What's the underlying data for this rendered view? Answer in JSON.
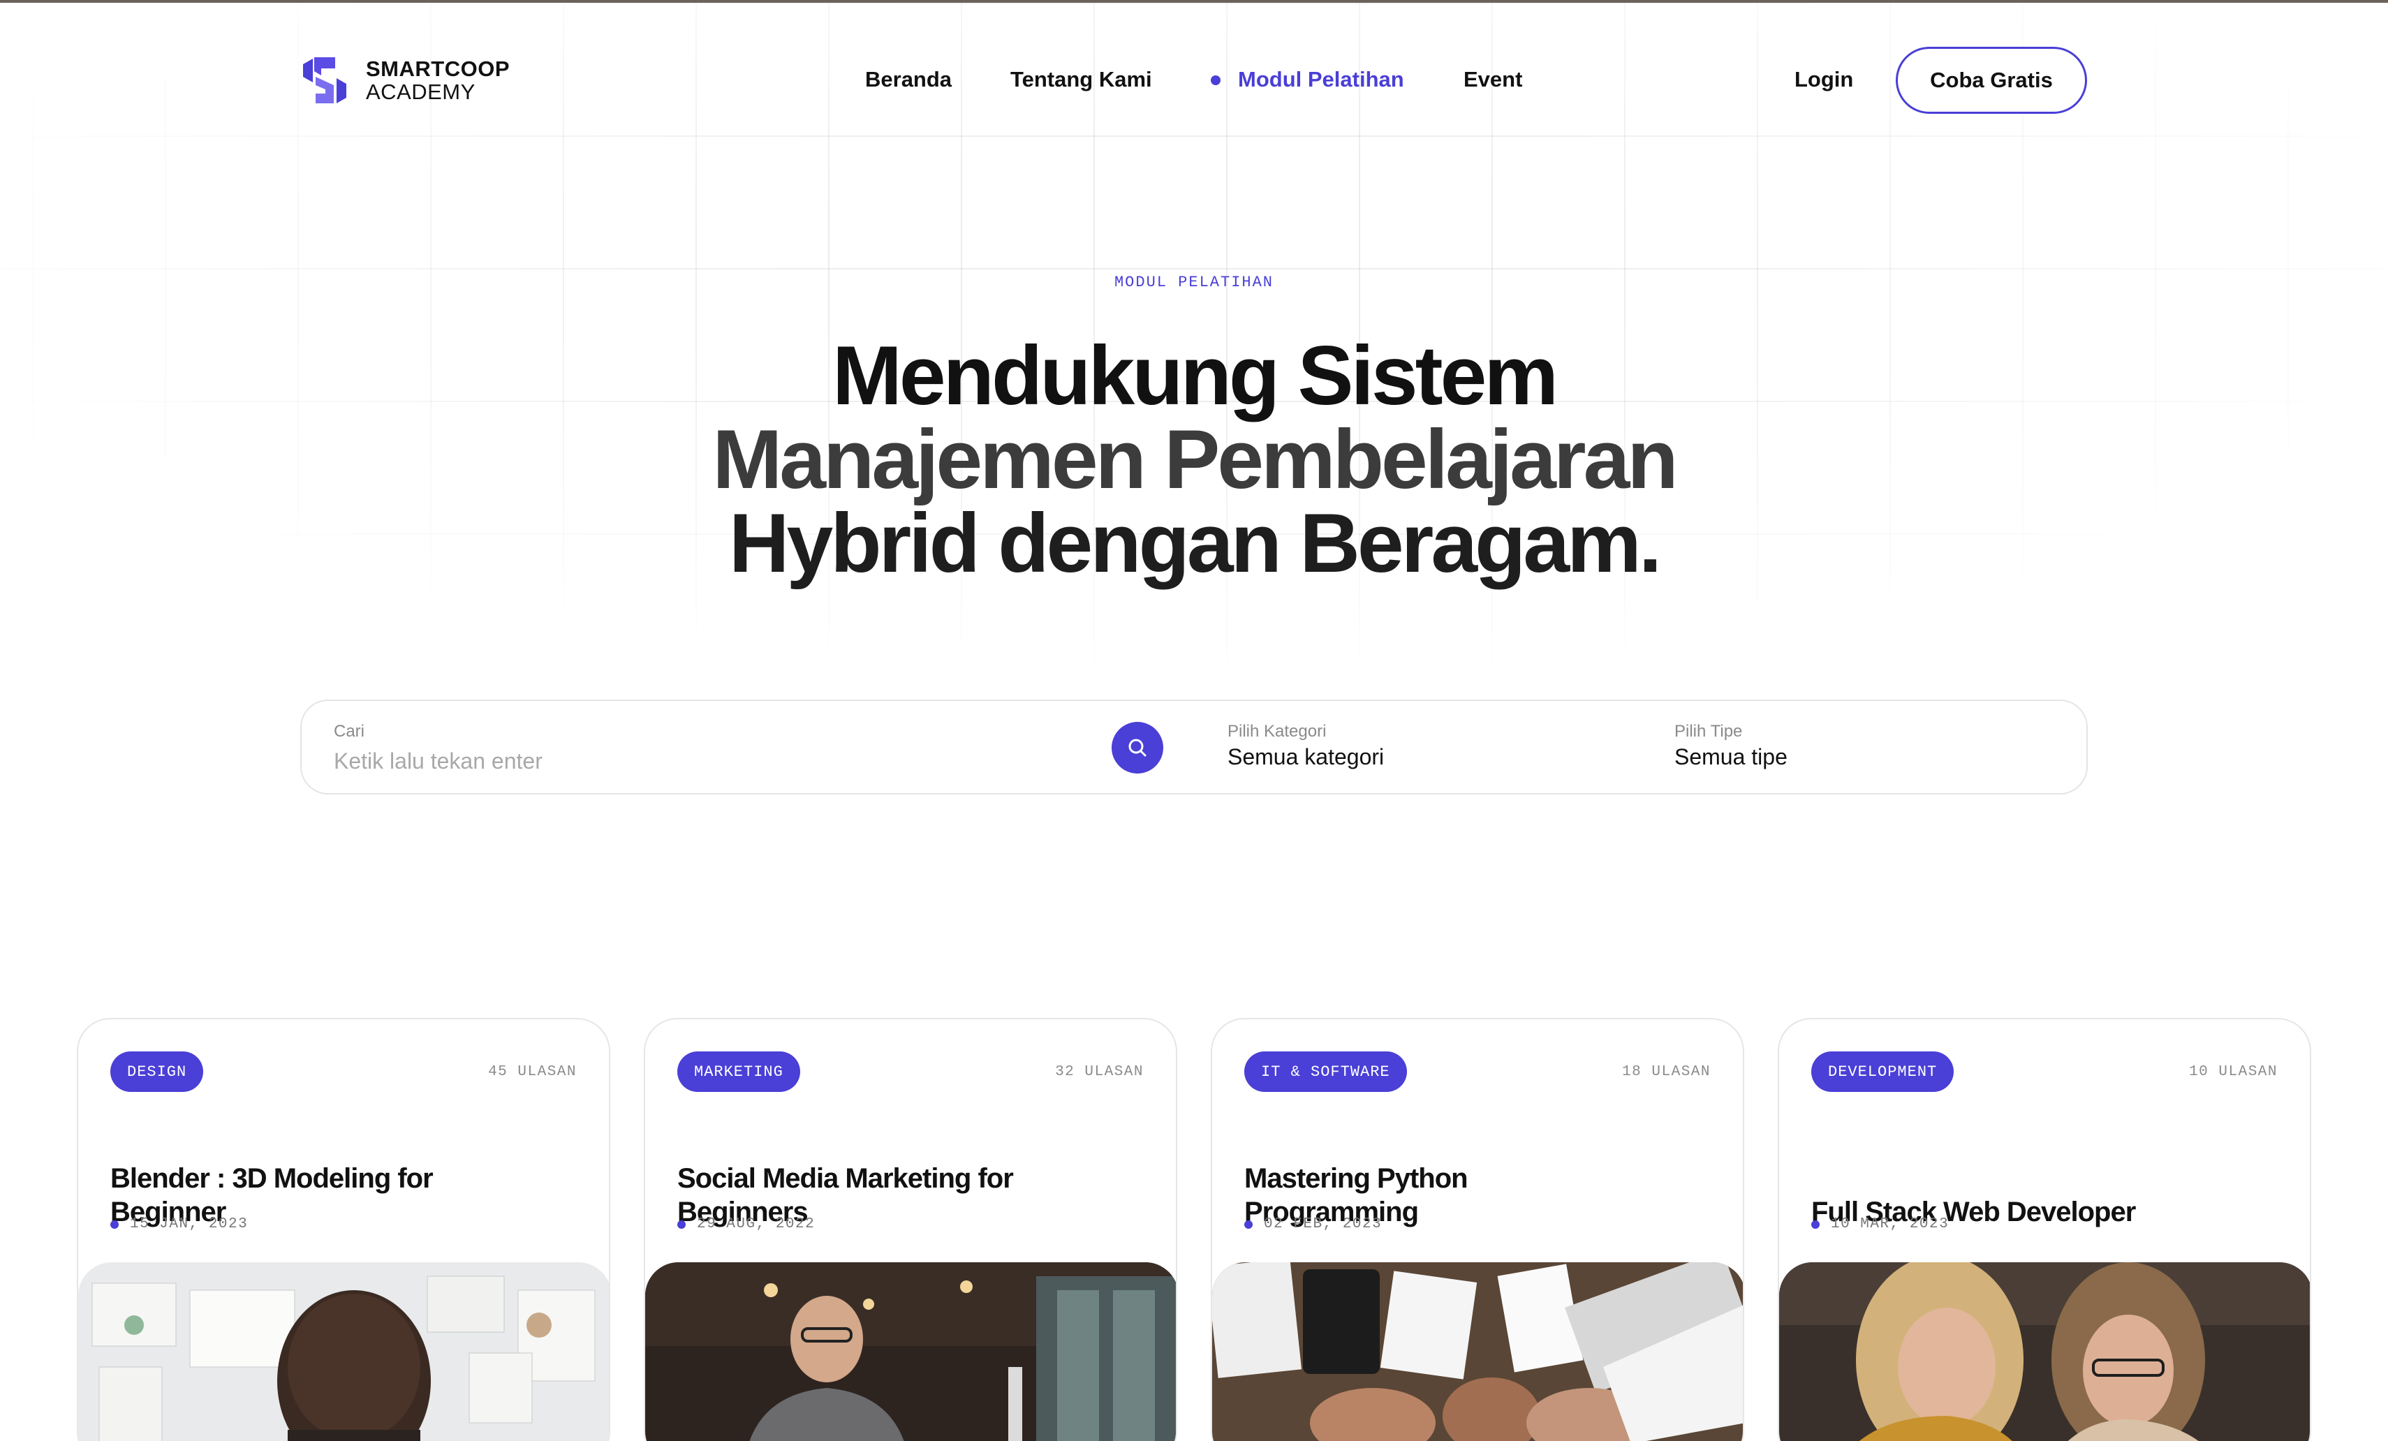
{
  "header": {
    "logo": {
      "line1": "SMARTCOOP",
      "line2": "ACADEMY"
    },
    "nav": [
      {
        "label": "Beranda",
        "active": false
      },
      {
        "label": "Tentang Kami",
        "active": false
      },
      {
        "label": "Modul Pelatihan",
        "active": true
      },
      {
        "label": "Event",
        "active": false
      }
    ],
    "login_label": "Login",
    "cta_label": "Coba Gratis"
  },
  "hero": {
    "eyebrow": "MODUL PELATIHAN",
    "headline": [
      "Mendukung Sistem",
      "Manajemen Pembelajaran",
      "Hybrid dengan Beragam."
    ]
  },
  "search": {
    "search_label": "Cari",
    "search_placeholder": "Ketik lalu tekan enter",
    "search_value": "",
    "category_label": "Pilih Kategori",
    "category_value": "Semua kategori",
    "type_label": "Pilih Tipe",
    "type_value": "Semua tipe"
  },
  "cards": [
    {
      "category": "DESIGN",
      "reviews": "45 ULASAN",
      "title": "Blender : 3D Modeling for Beginner",
      "date": "15 JAN, 2023"
    },
    {
      "category": "MARKETING",
      "reviews": "32 ULASAN",
      "title": "Social Media Marketing for Beginners",
      "date": "29 AUG, 2022"
    },
    {
      "category": "IT & SOFTWARE",
      "reviews": "18 ULASAN",
      "title": "Mastering Python Programming",
      "date": "02 FEB, 2023"
    },
    {
      "category": "DEVELOPMENT",
      "reviews": "10 ULASAN",
      "title": "Full Stack Web Developer",
      "date": "10 MAR, 2023"
    }
  ],
  "colors": {
    "accent": "#4a3fd6",
    "text": "#111111",
    "muted": "#8a8a8a",
    "border": "#e4e4e4"
  },
  "icons": {
    "search": "search-icon",
    "logo": "smartcoop-logo-icon"
  }
}
